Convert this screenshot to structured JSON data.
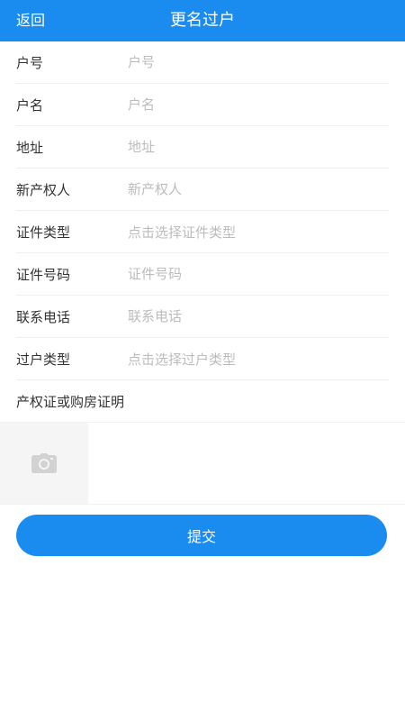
{
  "header": {
    "back_label": "返回",
    "title": "更名过户",
    "bg_color": "#1a8cf0"
  },
  "form": {
    "account_no": {
      "label": "户号",
      "placeholder": "户号"
    },
    "account_name": {
      "label": "户名",
      "placeholder": "户名"
    },
    "address": {
      "label": "地址",
      "placeholder": "地址"
    },
    "new_owner": {
      "label": "新产权人",
      "placeholder": "新产权人"
    },
    "id_type": {
      "label": "证件类型",
      "placeholder": "点击选择证件类型"
    },
    "id_number": {
      "label": "证件号码",
      "placeholder": "证件号码"
    },
    "phone": {
      "label": "联系电话",
      "placeholder": "联系电话"
    },
    "transfer_type": {
      "label": "过户类型",
      "placeholder": "点击选择过户类型"
    }
  },
  "attachment": {
    "title": "产权证或购房证明",
    "icon": "camera-icon"
  },
  "submit_label": "提交",
  "colors": {
    "primary": "#1a8cf0",
    "placeholder": "#bcbcbc",
    "text": "#333333"
  }
}
